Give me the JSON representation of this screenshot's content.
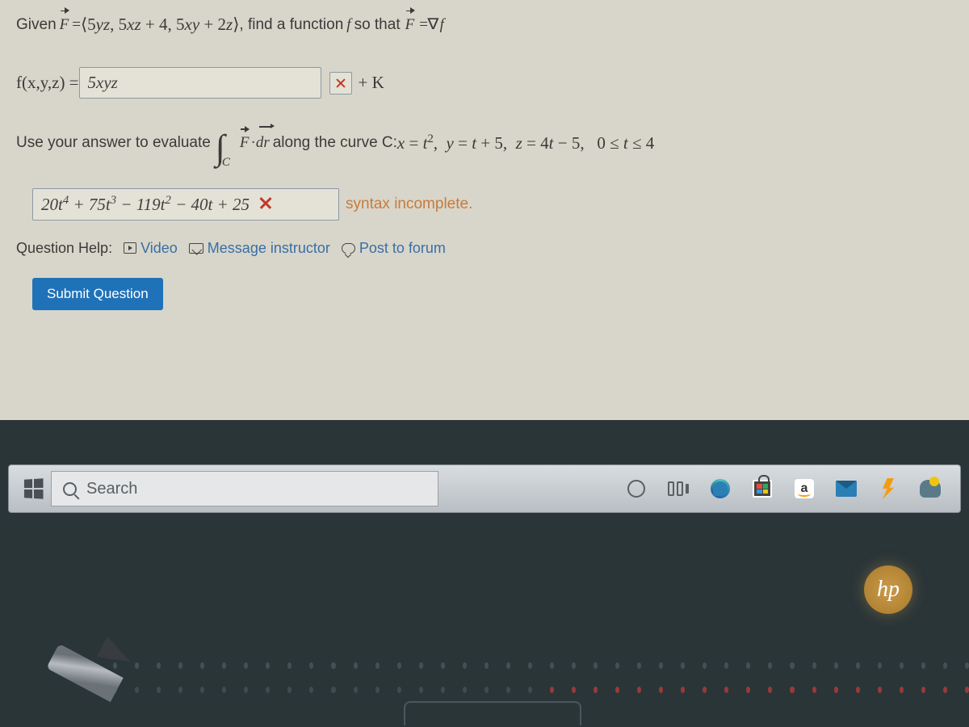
{
  "problem": {
    "given_prefix": "Given ",
    "F_vec": "F",
    "equals": " = ",
    "F_expr": "⟨5yz, 5xz + 4, 5xy + 2z⟩",
    "find_text": ", find a function ",
    "f_var": "f",
    "so_that": " so that ",
    "grad": "∇",
    "grad_f": "f"
  },
  "answer1": {
    "lhs": "f(x,y,z) = ",
    "value": "5xyz",
    "plus_k": " + K"
  },
  "part2": {
    "use_text": "Use your answer to evaluate ",
    "int_sub": "C",
    "F_vec": "F",
    "dot": " · ",
    "dr": "dr",
    "along": " along the curve C: ",
    "curve": "x = t², y = t + 5, z = 4t − 5,  0 ≤ t ≤ 4"
  },
  "answer2": {
    "value": "20t⁴ + 75t³ − 119t² − 40t + 25",
    "feedback": "syntax incomplete."
  },
  "help": {
    "label": "Question Help:",
    "video": "Video",
    "message": "Message instructor",
    "forum": "Post to forum"
  },
  "submit_label": "Submit Question",
  "taskbar": {
    "search_placeholder": "Search",
    "amazon_letter": "a"
  },
  "hp": "hp"
}
